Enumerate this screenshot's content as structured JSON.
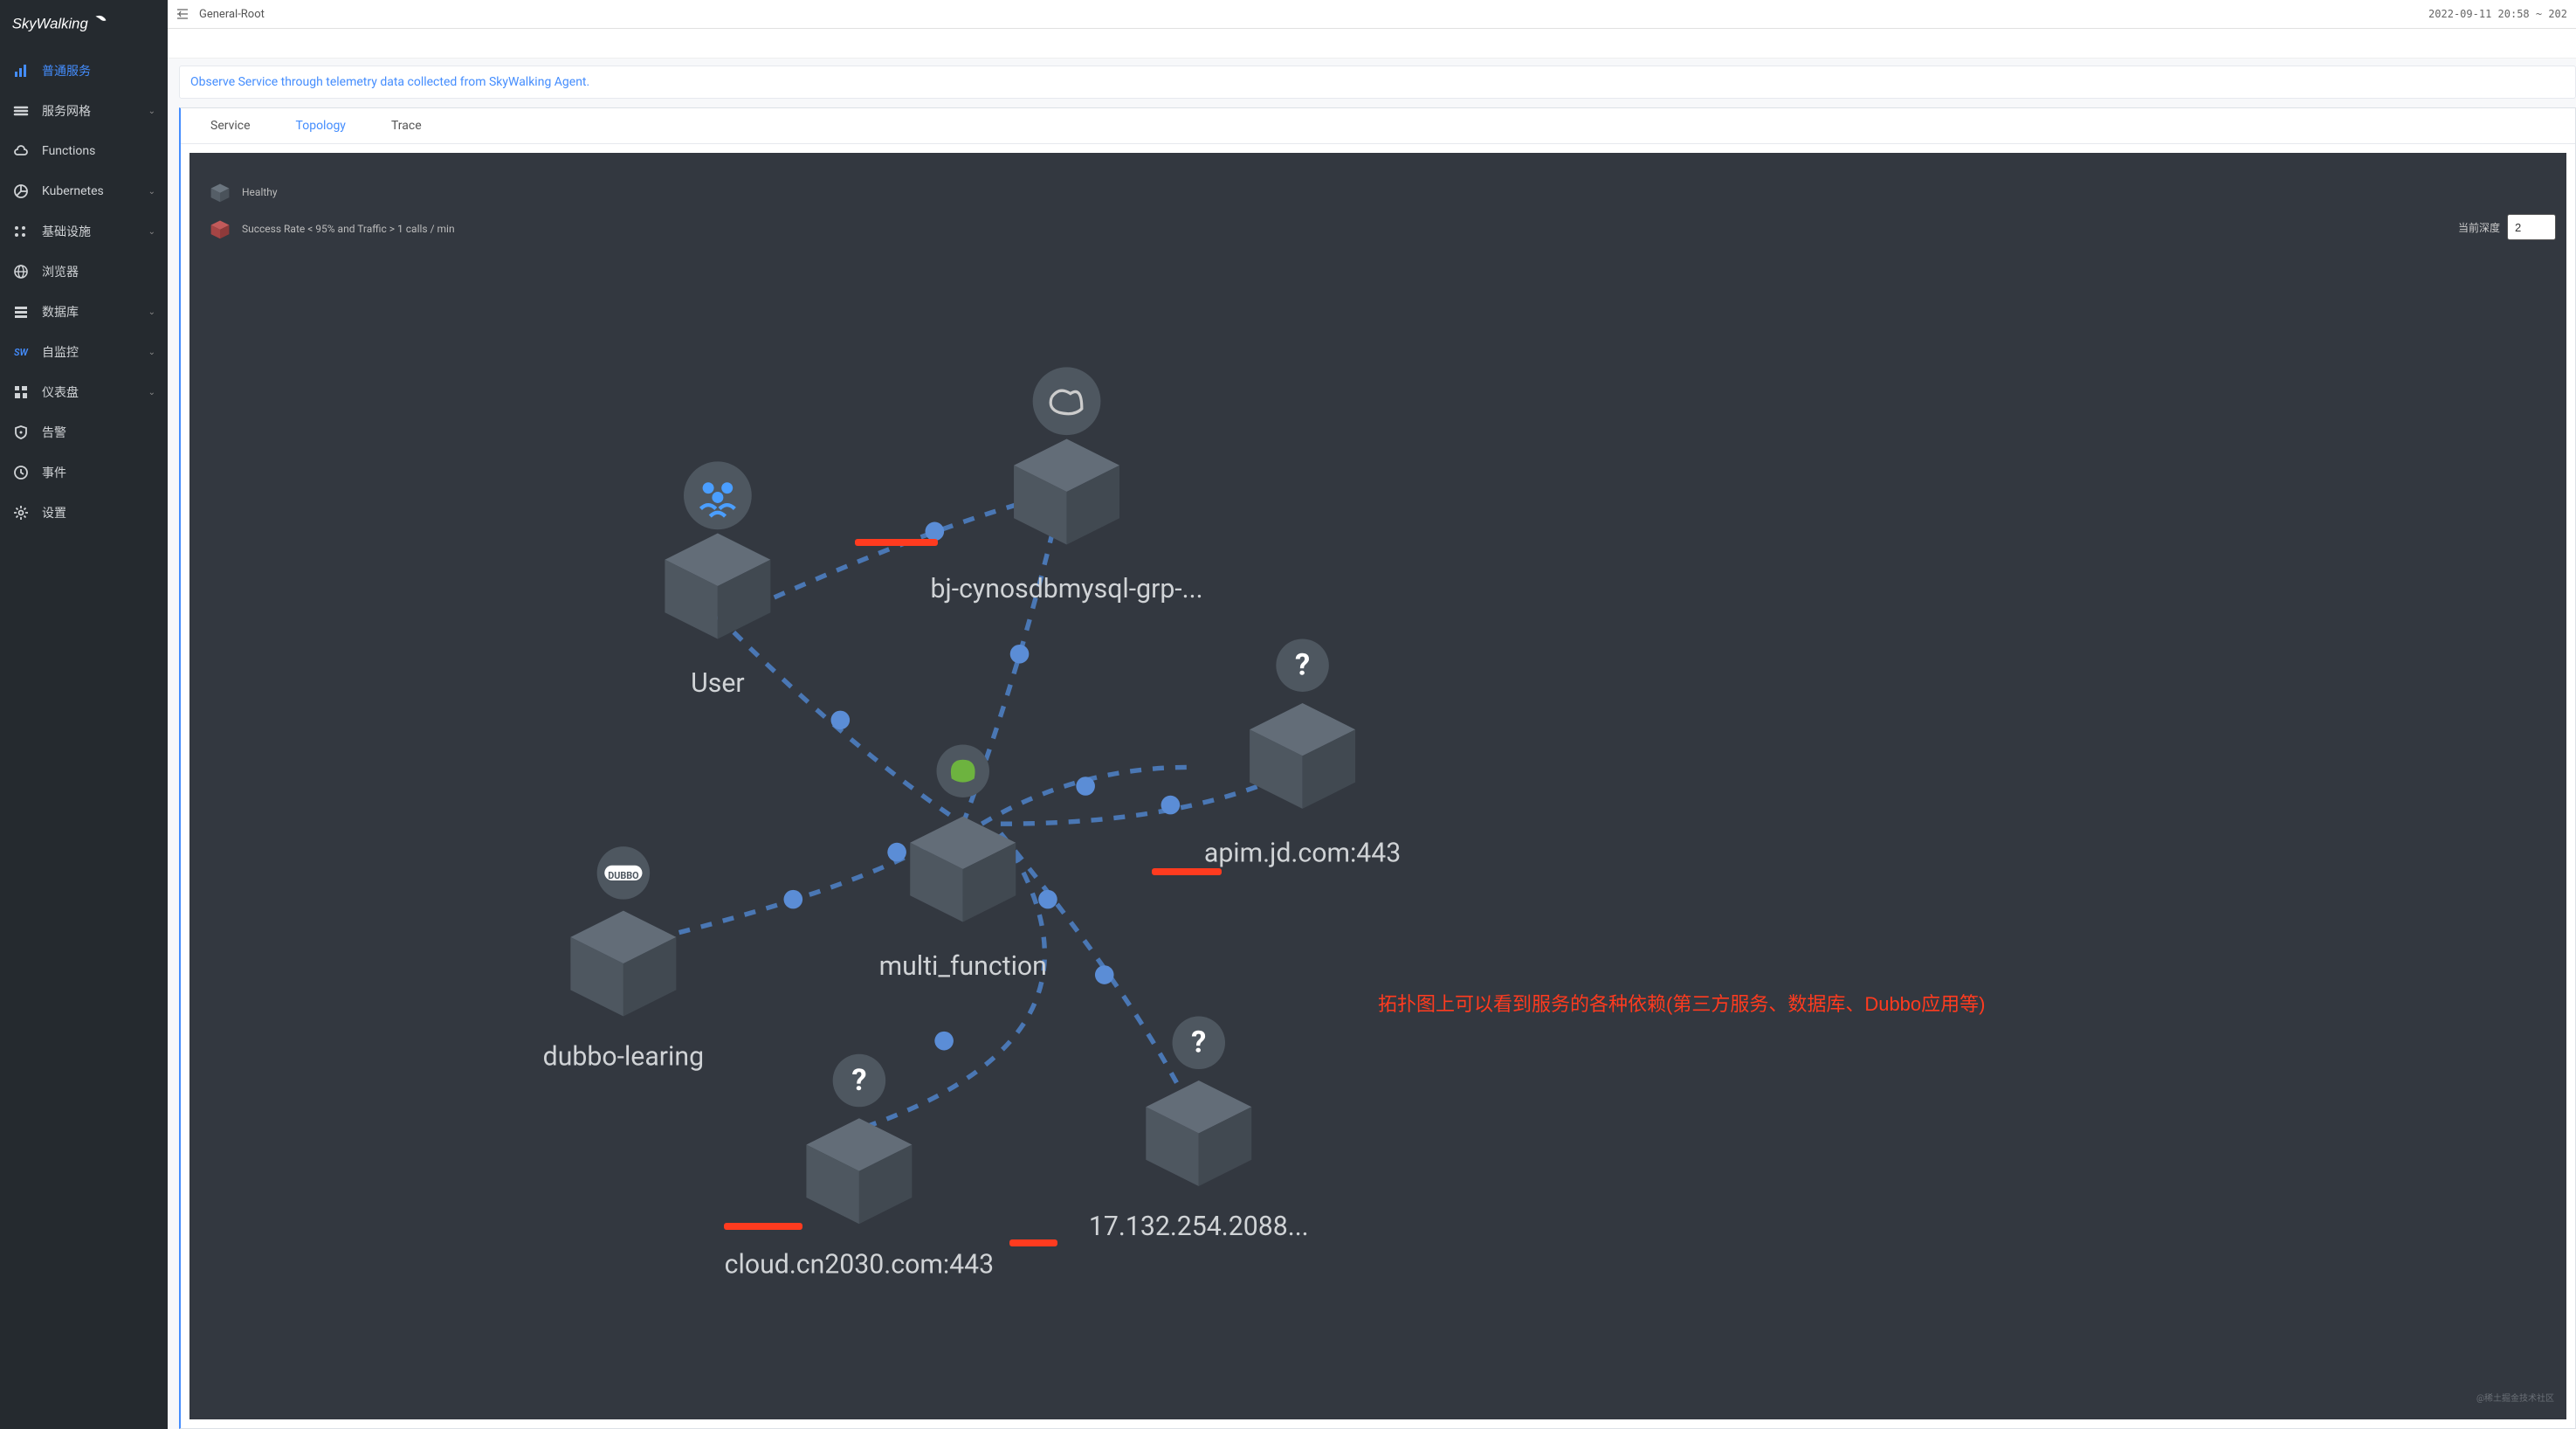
{
  "brand": "SkyWalking",
  "sidebar": {
    "items": [
      {
        "label": "普通服务",
        "icon": "bar-chart-icon",
        "active": true,
        "expandable": false
      },
      {
        "label": "服务网格",
        "icon": "layers-icon",
        "expandable": true
      },
      {
        "label": "Functions",
        "icon": "cloud-icon",
        "expandable": false
      },
      {
        "label": "Kubernetes",
        "icon": "pie-icon",
        "expandable": true
      },
      {
        "label": "基础设施",
        "icon": "dots-icon",
        "expandable": true
      },
      {
        "label": "浏览器",
        "icon": "globe-icon",
        "expandable": false
      },
      {
        "label": "数据库",
        "icon": "database-icon",
        "expandable": true
      },
      {
        "label": "自监控",
        "icon": "sw-icon",
        "expandable": true
      },
      {
        "label": "仪表盘",
        "icon": "grid-icon",
        "expandable": true
      },
      {
        "label": "告警",
        "icon": "shield-icon",
        "expandable": false
      },
      {
        "label": "事件",
        "icon": "clock-icon",
        "expandable": false
      },
      {
        "label": "设置",
        "icon": "gear-icon",
        "expandable": false
      }
    ]
  },
  "topbar": {
    "breadcrumb": "General-Root",
    "timerange": "2022-09-11 20:58 ~ 202"
  },
  "banner": "Observe Service through telemetry data collected from SkyWalking Agent.",
  "tabs": [
    {
      "label": "Service",
      "active": false
    },
    {
      "label": "Topology",
      "active": true
    },
    {
      "label": "Trace",
      "active": false
    }
  ],
  "legend": {
    "healthy": "Healthy",
    "unhealthy": "Success Rate < 95% and Traffic > 1 calls / min"
  },
  "depth": {
    "label": "当前深度",
    "value": "2"
  },
  "topology": {
    "nodes": [
      {
        "id": "user",
        "label": "User",
        "badge": "users"
      },
      {
        "id": "mysql",
        "label": "bj-cynosdbmysql-grp-...",
        "badge": "mysql",
        "redacted": true
      },
      {
        "id": "dubbo",
        "label": "dubbo-learing",
        "badge": "dubbo"
      },
      {
        "id": "multi",
        "label": "multi_function",
        "badge": "spring"
      },
      {
        "id": "api443",
        "label": "apim.jd.com:443",
        "badge": "question",
        "redacted": true
      },
      {
        "id": "cloud443",
        "label": "cloud.cn2030.com:443",
        "badge": "question",
        "redacted": true
      },
      {
        "id": "node2088",
        "label": "17.132.254.2088...",
        "badge": "question",
        "redacted": true
      }
    ]
  },
  "annotation": "拓扑图上可以看到服务的各种依赖(第三方服务、数据库、Dubbo应用等)",
  "watermark": "@稀土掘金技术社区"
}
